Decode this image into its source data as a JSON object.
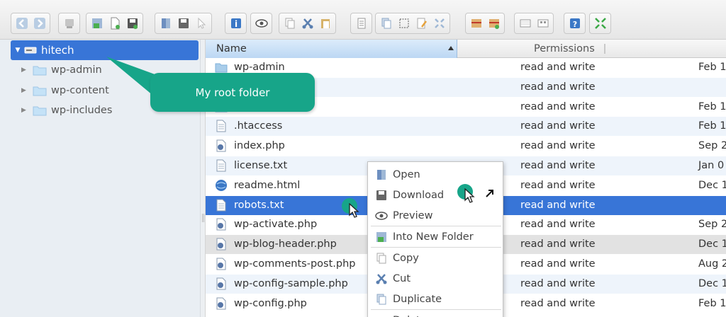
{
  "toolbar": {
    "groups": [
      {
        "name": "history",
        "buttons": [
          "back-icon",
          "forward-icon"
        ]
      },
      {
        "name": "home",
        "buttons": [
          "home-icon"
        ]
      },
      {
        "name": "upload",
        "buttons": [
          "reload-icon",
          "new-file-icon",
          "save-icon"
        ]
      },
      {
        "name": "open",
        "buttons": [
          "open-icon",
          "download-icon",
          "cursor-icon"
        ]
      },
      {
        "name": "info",
        "buttons": [
          "info-icon"
        ]
      },
      {
        "name": "preview",
        "buttons": [
          "eye-icon"
        ]
      },
      {
        "name": "clipboard",
        "buttons": [
          "copy-icon",
          "cut-icon",
          "paste-icon"
        ]
      },
      {
        "name": "edit",
        "buttons": [
          "edit-icon"
        ]
      },
      {
        "name": "files",
        "buttons": [
          "duplicate-icon",
          "select-icon",
          "rename-icon",
          "resize-icon"
        ]
      },
      {
        "name": "archive",
        "buttons": [
          "archive-icon",
          "extract-icon"
        ]
      },
      {
        "name": "view",
        "buttons": [
          "list-view-icon",
          "icon-view-icon"
        ]
      },
      {
        "name": "help",
        "buttons": [
          "help-icon"
        ]
      },
      {
        "name": "fullscreen",
        "buttons": [
          "fullscreen-icon"
        ]
      }
    ]
  },
  "tree": {
    "root": "hitech",
    "items": [
      "wp-admin",
      "wp-content",
      "wp-includes"
    ]
  },
  "table": {
    "columns": {
      "name": "Name",
      "permissions": "Permissions"
    },
    "rows": [
      {
        "name": "wp-admin",
        "type": "folder",
        "perm": "read and write",
        "date": "Feb 1"
      },
      {
        "name": "",
        "type": "folder",
        "perm": "read and write",
        "date": ""
      },
      {
        "name": "",
        "type": "folder",
        "perm": "read and write",
        "date": "Feb 1"
      },
      {
        "name": ".htaccess",
        "type": "text",
        "perm": "read and write",
        "date": "Feb 1"
      },
      {
        "name": "index.php",
        "type": "php",
        "perm": "read and write",
        "date": "Sep 2"
      },
      {
        "name": "license.txt",
        "type": "text",
        "perm": "read and write",
        "date": "Jan 0"
      },
      {
        "name": "readme.html",
        "type": "html",
        "perm": "read and write",
        "date": "Dec 1"
      },
      {
        "name": "robots.txt",
        "type": "text",
        "perm": "read and write",
        "date": ""
      },
      {
        "name": "wp-activate.php",
        "type": "php",
        "perm": "read and write",
        "date": "Sep 2"
      },
      {
        "name": "wp-blog-header.php",
        "type": "php",
        "perm": "read and write",
        "date": "Dec 1"
      },
      {
        "name": "wp-comments-post.php",
        "type": "php",
        "perm": "read and write",
        "date": "Aug 2"
      },
      {
        "name": "wp-config-sample.php",
        "type": "php",
        "perm": "read and write",
        "date": "Dec 1"
      },
      {
        "name": "wp-config.php",
        "type": "php",
        "perm": "read and write",
        "date": "Feb 1"
      }
    ]
  },
  "context_menu": {
    "items": [
      {
        "label": "Open",
        "icon": "open-icon"
      },
      {
        "label": "Download",
        "icon": "download-icon"
      },
      {
        "label": "Preview",
        "icon": "eye-icon"
      },
      {
        "label": "Into New Folder",
        "icon": "new-folder-icon"
      },
      {
        "label": "Copy",
        "icon": "copy-icon"
      },
      {
        "label": "Cut",
        "icon": "cut-icon"
      },
      {
        "label": "Duplicate",
        "icon": "duplicate-icon"
      },
      {
        "label": "Delete",
        "icon": "delete-icon"
      }
    ]
  },
  "annotation": {
    "callout": "My root folder"
  },
  "colors": {
    "selection": "#3875d7",
    "annotation": "#17a589",
    "alt_row": "#eef4fb"
  }
}
